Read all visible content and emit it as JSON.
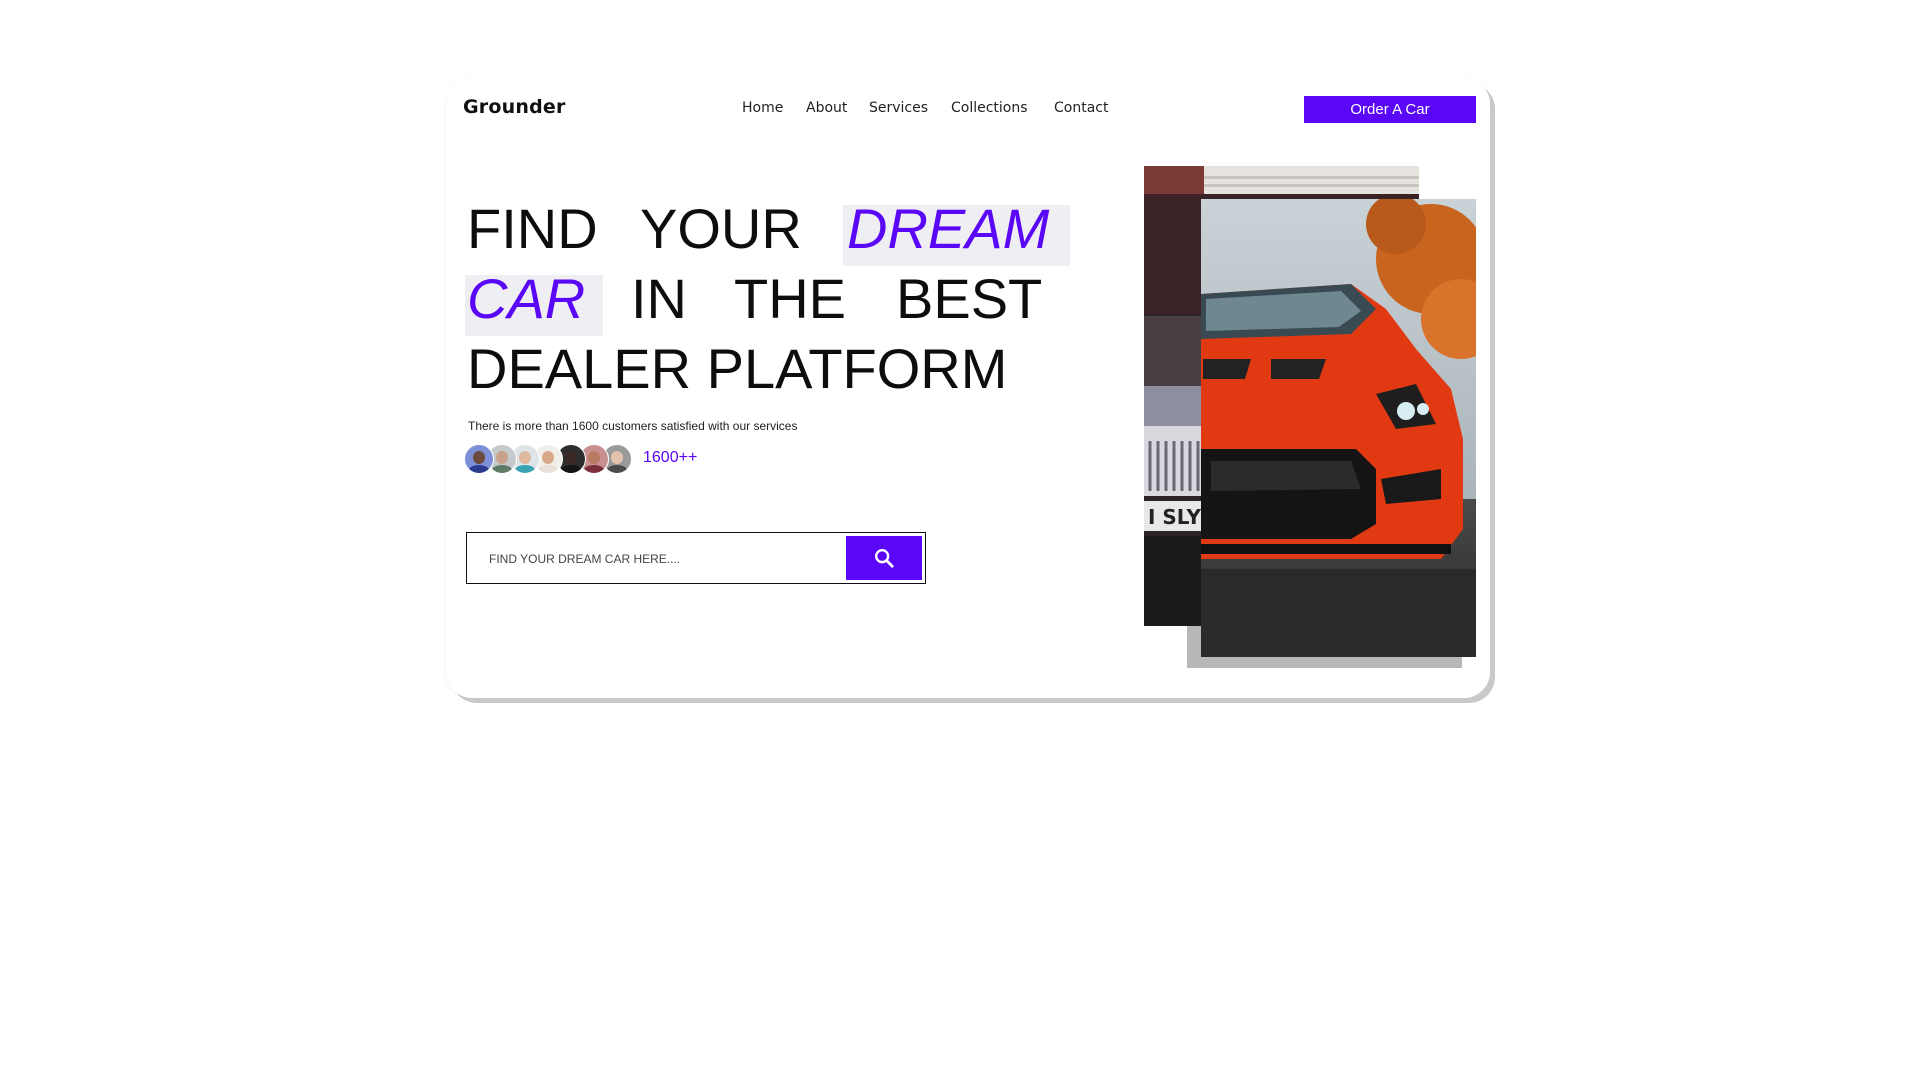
{
  "brand": {
    "name": "Grounder",
    "accent_color": "#5a06f7"
  },
  "nav": {
    "items": [
      "Home",
      "About",
      "Services",
      "Collections",
      "Contact"
    ],
    "cta_label": "Order A Car"
  },
  "hero": {
    "headline": {
      "line1_a": "FIND",
      "line1_b": "YOUR",
      "line1_accent": "DREAM",
      "line2_accent": "CAR",
      "line2_a": "IN",
      "line2_b": "THE",
      "line2_c": "BEST",
      "line3": "DEALER PLATFORM"
    },
    "tagline": "There is more than 1600 customers satisfied with our services",
    "customer_count": "1600++",
    "avatars": [
      {
        "skin": "#6c4a3c",
        "shirt": "#2a3b8f",
        "bg": "#7d8fd6"
      },
      {
        "skin": "#c9a089",
        "shirt": "#5f7a66",
        "bg": "#c5c9cc"
      },
      {
        "skin": "#e0b9a1",
        "shirt": "#3aa3b3",
        "bg": "#dfe4e8"
      },
      {
        "skin": "#d8a88a",
        "shirt": "#e9e1d8",
        "bg": "#f0eee9"
      },
      {
        "skin": "#3b2a24",
        "shirt": "#151515",
        "bg": "#2e2e2e"
      },
      {
        "skin": "#b97a62",
        "shirt": "#7a2f3b",
        "bg": "#c98f8f"
      },
      {
        "skin": "#e3c2ad",
        "shirt": "#4b4b4b",
        "bg": "#9a9a9a"
      }
    ]
  },
  "search": {
    "placeholder": "FIND YOUR DREAM CAR HERE....",
    "button_icon": "search-icon"
  },
  "photos": {
    "back_plate_text": "I SLY",
    "back_description_icon": "car-grille-photo",
    "front_description_icon": "red-sports-car-photo"
  }
}
